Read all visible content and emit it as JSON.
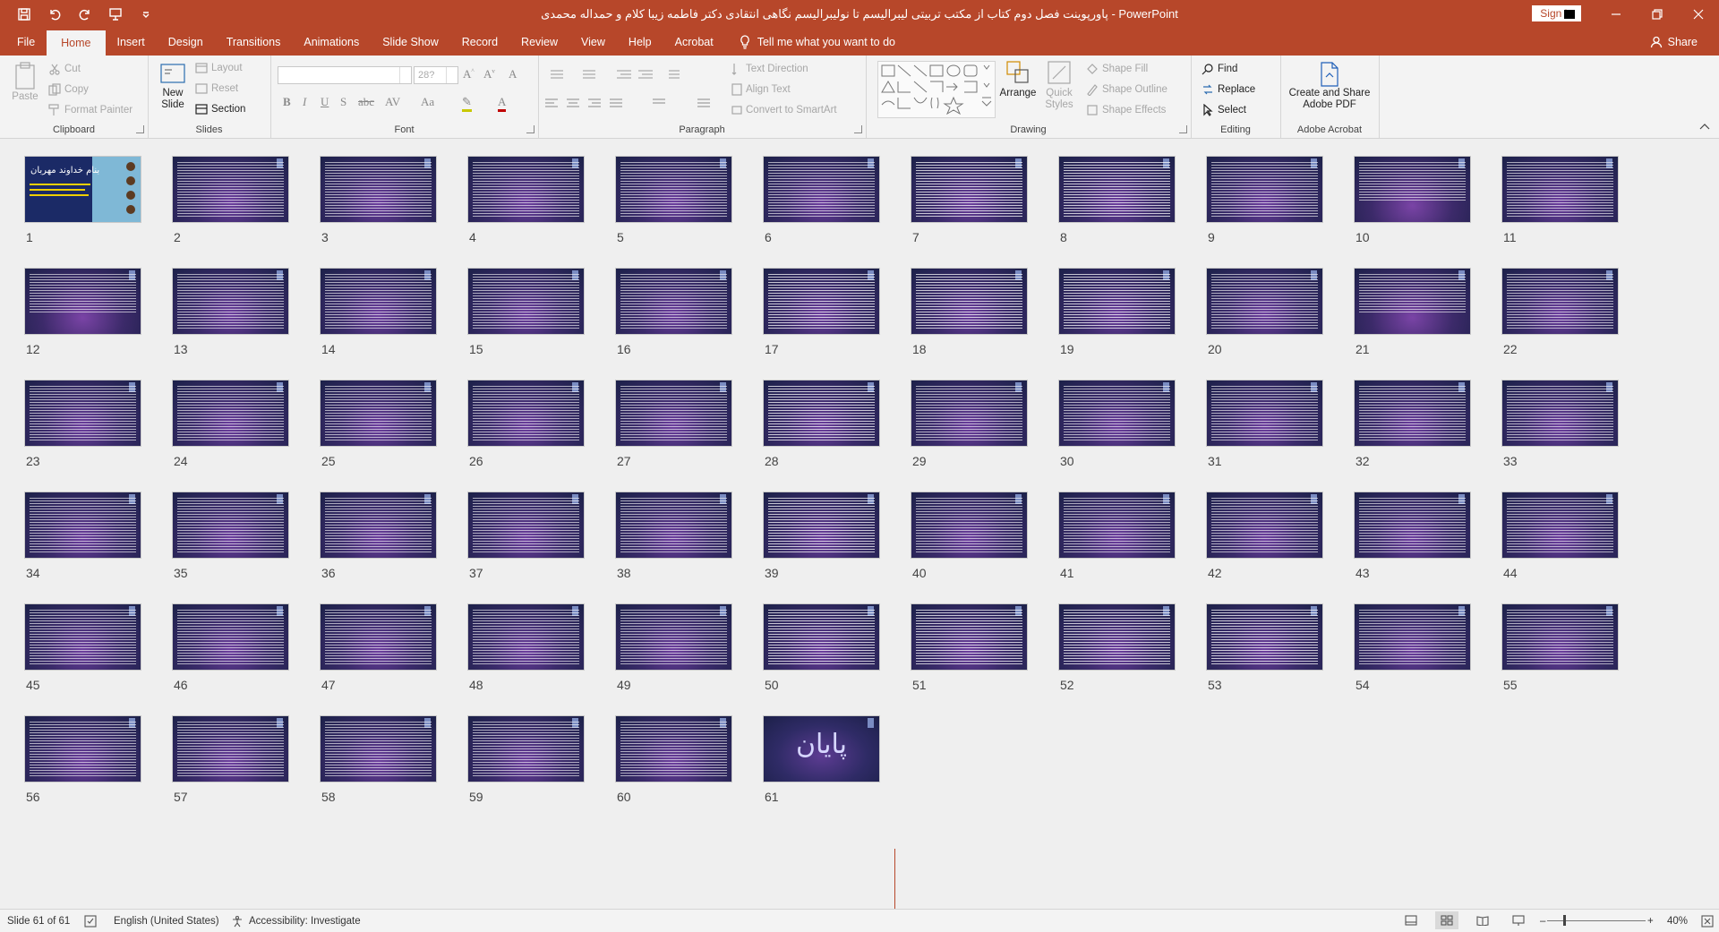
{
  "window": {
    "title": "پاورپوینت فصل دوم کتاب از مکتب تربیتی لیبرالیسم تا نولیبرالیسم نگاهی انتقادی دکتر فاطمه زیبا کلام و حمداله محمدی  -  PowerPoint",
    "signin_label": "Sign in"
  },
  "tabs": [
    "File",
    "Home",
    "Insert",
    "Design",
    "Transitions",
    "Animations",
    "Slide Show",
    "Record",
    "Review",
    "View",
    "Help",
    "Acrobat"
  ],
  "active_tab": "Home",
  "tell_me": "Tell me what you want to do",
  "share_label": "Share",
  "ribbon": {
    "clipboard": {
      "label": "Clipboard",
      "paste": "Paste",
      "cut": "Cut",
      "copy": "Copy",
      "format_painter": "Format Painter"
    },
    "slides": {
      "label": "Slides",
      "new_slide": "New Slide",
      "layout": "Layout",
      "reset": "Reset",
      "section": "Section"
    },
    "font": {
      "label": "Font",
      "size_value": "28?"
    },
    "paragraph": {
      "label": "Paragraph",
      "text_direction": "Text Direction",
      "align_text": "Align Text",
      "convert_smartart": "Convert to SmartArt"
    },
    "drawing": {
      "label": "Drawing",
      "arrange": "Arrange",
      "quick_styles": "Quick Styles",
      "shape_fill": "Shape Fill",
      "shape_outline": "Shape Outline",
      "shape_effects": "Shape Effects"
    },
    "editing": {
      "label": "Editing",
      "find": "Find",
      "replace": "Replace",
      "select": "Select"
    },
    "acrobat": {
      "label": "Adobe Acrobat",
      "create_share_line1": "Create and Share",
      "create_share_line2": "Adobe PDF"
    }
  },
  "slides": {
    "count": 61,
    "slide1_title": "بنام خداوند مهربان",
    "end_text": "پایان"
  },
  "status": {
    "slide_indicator": "Slide 61 of 61",
    "language": "English (United States)",
    "accessibility": "Accessibility: Investigate",
    "zoom": "40%"
  }
}
